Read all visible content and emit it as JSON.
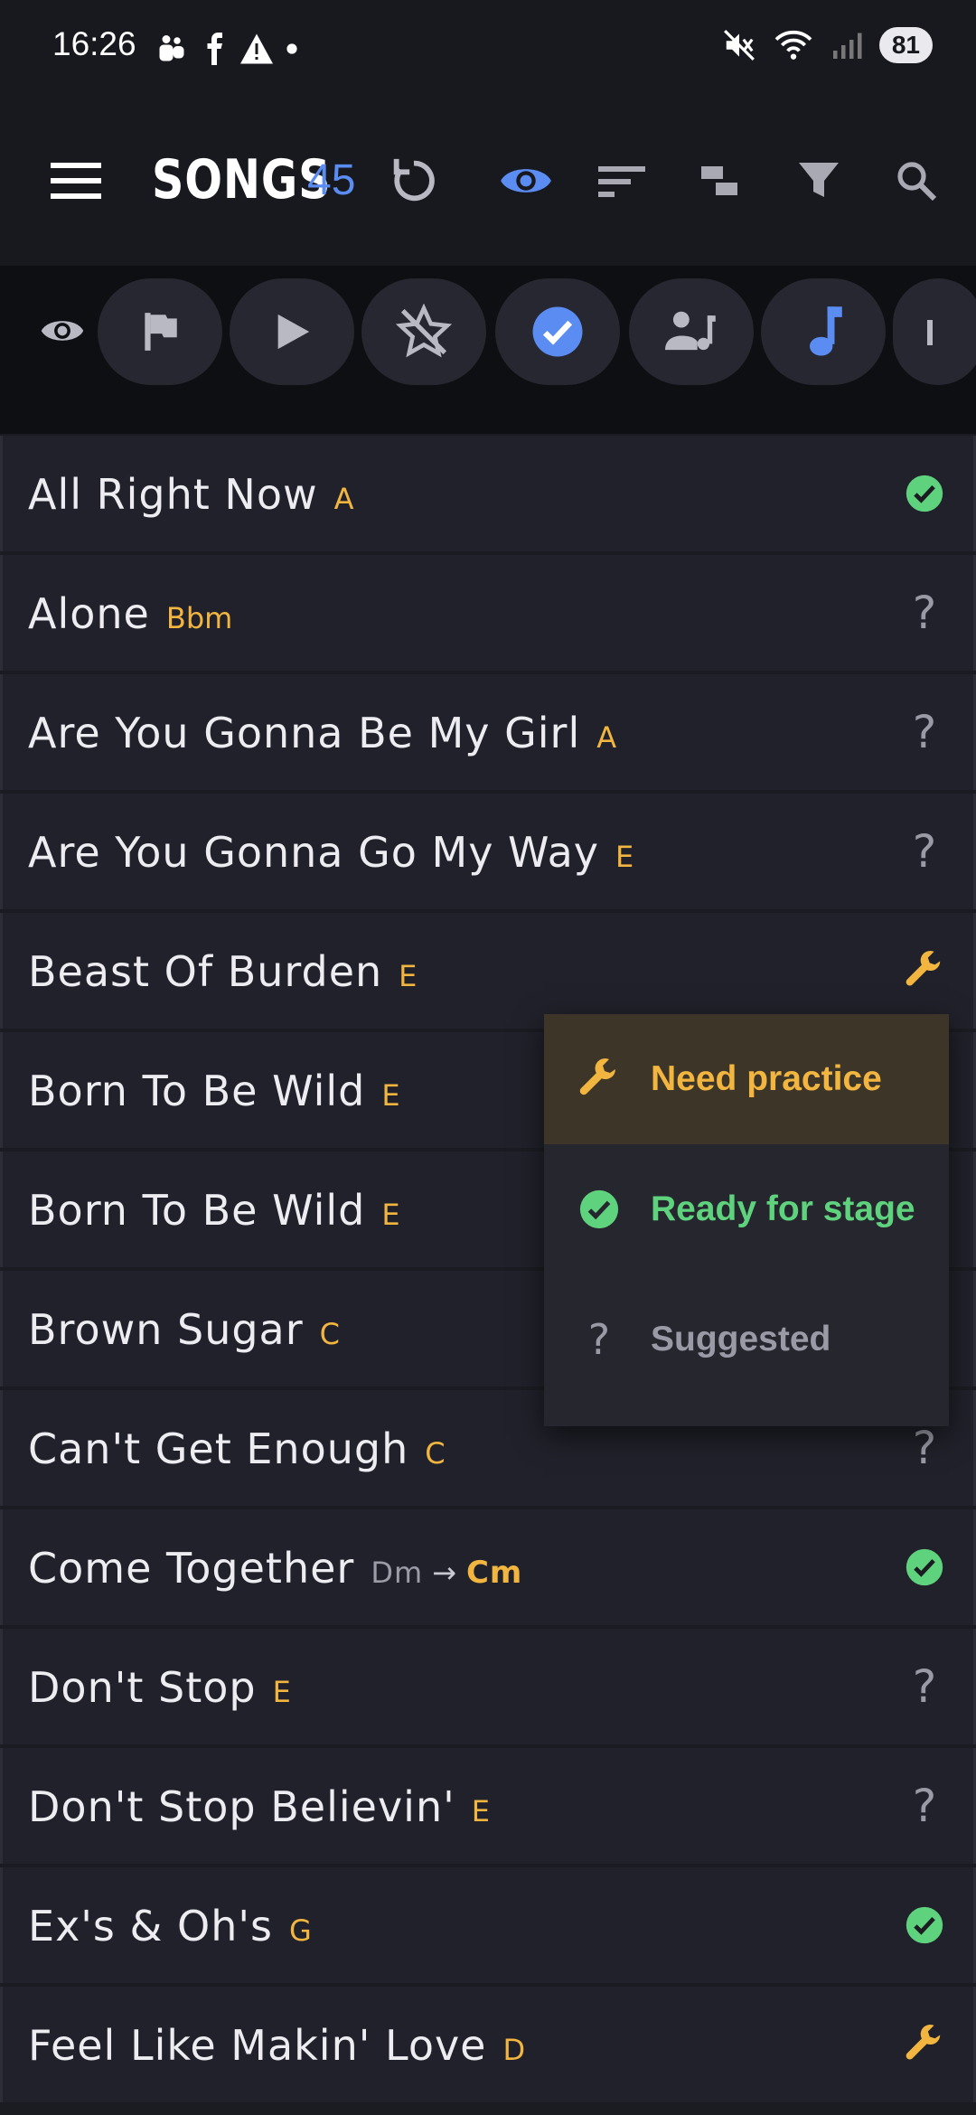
{
  "status_bar": {
    "time": "16:26",
    "battery": "81"
  },
  "toolbar": {
    "title": "SONGS",
    "count": "45"
  },
  "songs": [
    {
      "name": "All Right Now",
      "key": "A",
      "status": "ready"
    },
    {
      "name": "Alone",
      "key": "Bbm",
      "status": "suggested"
    },
    {
      "name": "Are You Gonna Be My Girl",
      "key": "A",
      "status": "suggested"
    },
    {
      "name": "Are You Gonna Go My Way",
      "key": "E",
      "status": "suggested"
    },
    {
      "name": "Beast Of Burden",
      "key": "E",
      "status": "practice"
    },
    {
      "name": "Born To Be Wild",
      "key": "E",
      "status": ""
    },
    {
      "name": "Born To Be Wild",
      "key": "E",
      "status": ""
    },
    {
      "name": "Brown Sugar",
      "key": "C",
      "status": ""
    },
    {
      "name": "Can't Get Enough",
      "key": "C",
      "status": "suggested"
    },
    {
      "name": "Come Together",
      "key_from": "Dm",
      "key_arrow": "→",
      "key_to": "Cm",
      "status": "ready"
    },
    {
      "name": "Don't Stop",
      "key": "E",
      "status": "suggested"
    },
    {
      "name": "Don't Stop Believin'",
      "key": "E",
      "status": "suggested"
    },
    {
      "name": "Ex's & Oh's",
      "key": "G",
      "status": "ready"
    },
    {
      "name": "Feel Like Makin' Love",
      "key": "D",
      "status": "practice"
    }
  ],
  "status_menu": {
    "items": [
      {
        "label": "Need practice",
        "icon": "wrench-icon",
        "color": "#f2b640"
      },
      {
        "label": "Ready for stage",
        "icon": "check-circle-icon",
        "color": "#5fd27e"
      },
      {
        "label": "Suggested",
        "icon": "question-icon",
        "color": "#9a9aa6"
      }
    ]
  },
  "colors": {
    "accent": "#5a8cf2",
    "key": "#f2b640",
    "ready": "#5fd27e",
    "practice": "#f2b640"
  }
}
